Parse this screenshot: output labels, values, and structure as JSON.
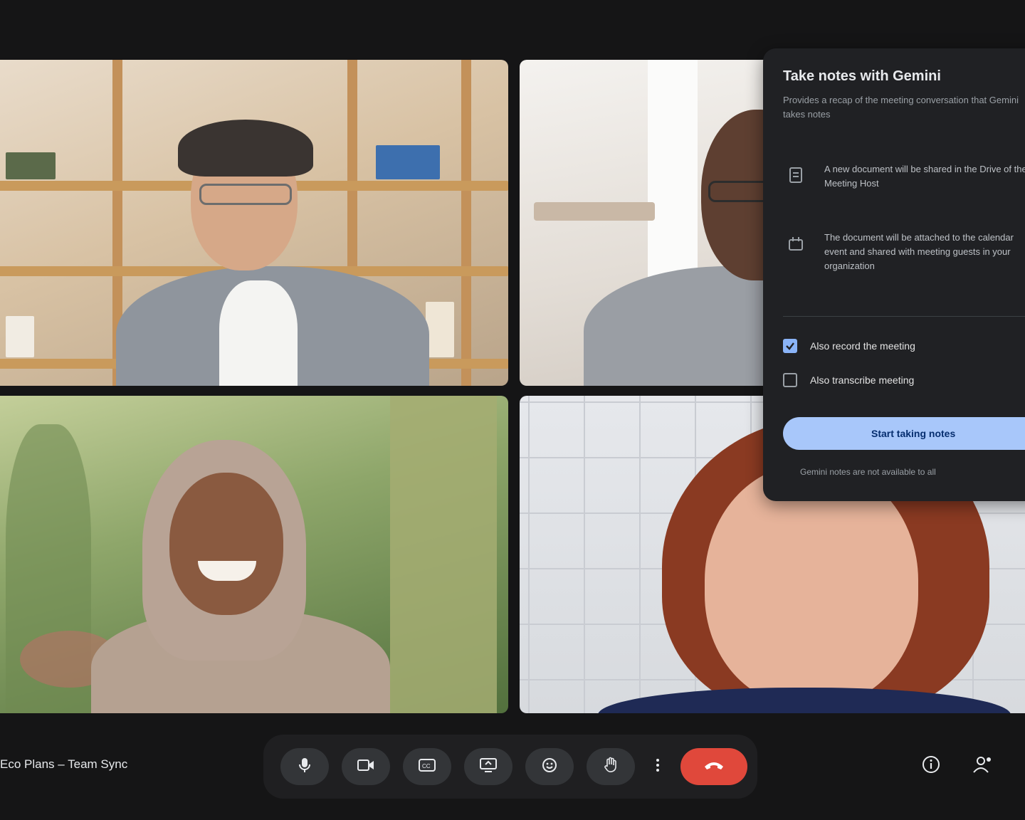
{
  "meeting": {
    "name": "Eco Plans – Team Sync"
  },
  "notes_panel": {
    "title": "Take notes with Gemini",
    "description": "Provides a recap of the meeting conversation that Gemini takes notes",
    "info_items": [
      {
        "icon": "document-icon",
        "text": "A new document will be shared in the Drive of the Meeting Host"
      },
      {
        "icon": "attachment-icon",
        "text": "The document will be attached to the calendar event and shared with meeting guests in your organization"
      }
    ],
    "options": [
      {
        "label": "Also record the meeting",
        "checked": true
      },
      {
        "label": "Also transcribe meeting",
        "checked": false
      }
    ],
    "start_button": "Start taking notes",
    "footnote": "Gemini notes are not available to all"
  },
  "controls": [
    {
      "icon": "microphone-icon"
    },
    {
      "icon": "camera-icon"
    },
    {
      "icon": "captions-icon"
    },
    {
      "icon": "present-screen-icon"
    },
    {
      "icon": "emoji-reactions-icon"
    },
    {
      "icon": "raise-hand-icon"
    },
    {
      "icon": "more-options-icon"
    },
    {
      "icon": "end-call-icon"
    }
  ],
  "right_icons": [
    {
      "icon": "info-icon"
    },
    {
      "icon": "people-icon"
    },
    {
      "icon": "chat-icon"
    }
  ],
  "colors": {
    "background": "#151516",
    "panel": "#202124",
    "button_primary": "#a8c7fa",
    "end_call": "#e0483b"
  }
}
